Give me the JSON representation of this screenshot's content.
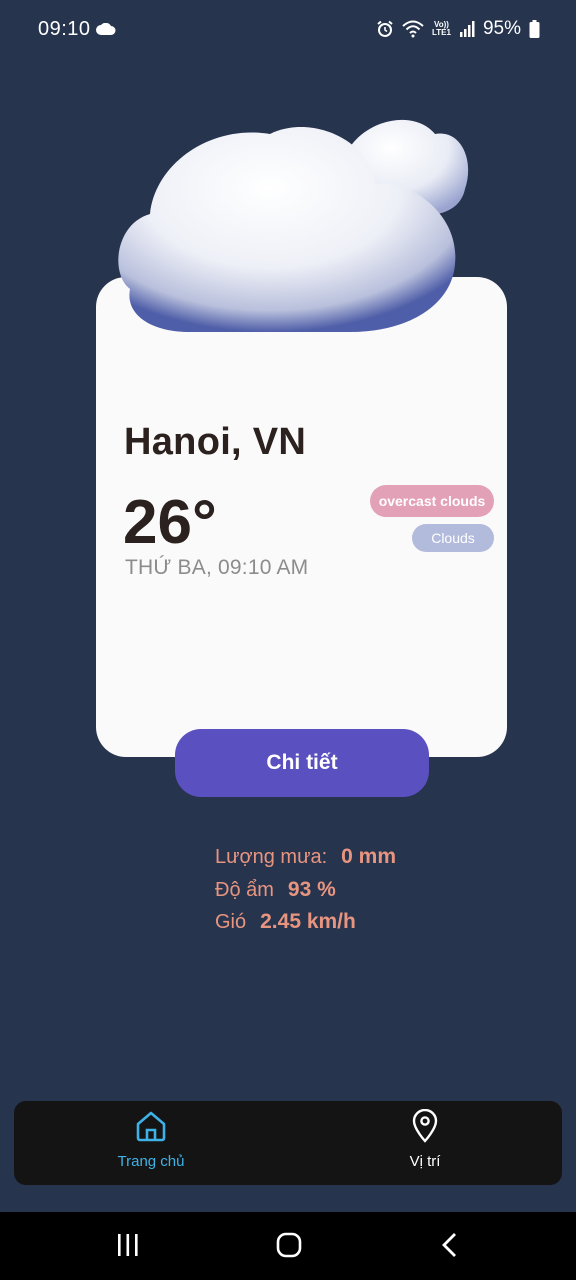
{
  "status_bar": {
    "time": "09:10",
    "battery": "95%",
    "icons": [
      "cloud-icon",
      "alarm-icon",
      "wifi-icon",
      "volte-icon",
      "signal-icon",
      "battery-icon"
    ],
    "lte_top": "Vo))",
    "lte_bottom": "LTE1"
  },
  "weather": {
    "city": "Hanoi, VN",
    "temperature": "26°",
    "datetime": "THỨ BA, 09:10 AM",
    "description": "overcast clouds",
    "main": "Clouds",
    "icon": "cloud-illustration"
  },
  "detail_button": {
    "label": "Chi tiết"
  },
  "info": {
    "rain_label": "Lượng mưa:",
    "rain_value": "0 mm",
    "humidity_label": "Độ ẩm",
    "humidity_value": "93 %",
    "wind_label": "Gió",
    "wind_value": "2.45 km/h"
  },
  "bottom_nav": {
    "items": [
      {
        "label": "Trang chủ",
        "icon": "home-icon",
        "active": true
      },
      {
        "label": "Vị trí",
        "icon": "location-pin-icon",
        "active": false
      }
    ]
  },
  "colors": {
    "background": "#27344e",
    "card": "#fafafa",
    "accent_button": "#5b50c0",
    "chip_description": "#e3a1b7",
    "chip_main": "#b3bbdc",
    "info_text": "#e89580",
    "nav_active": "#3eb2e6"
  }
}
